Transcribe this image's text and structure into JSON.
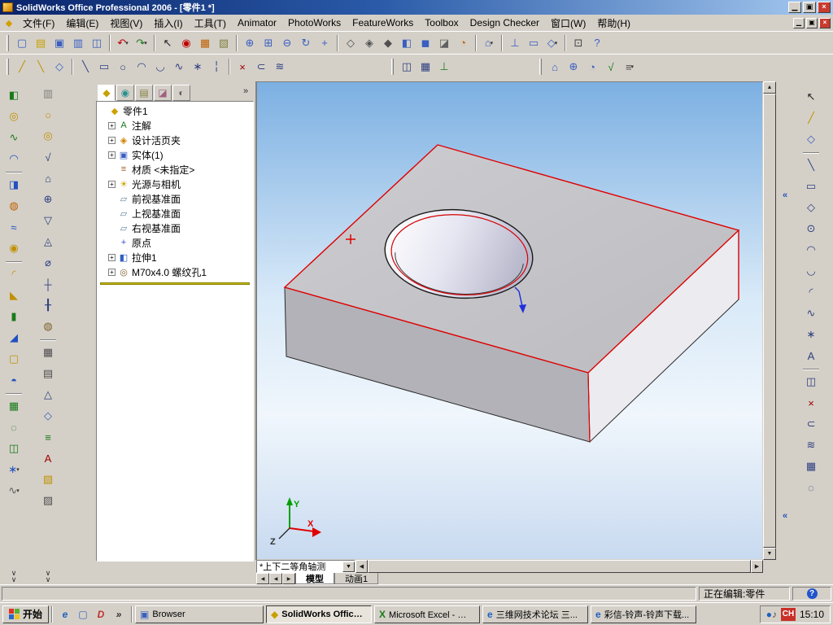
{
  "colors": {
    "titlebar_start": "#0a246a",
    "titlebar_end": "#a6caf0",
    "edge_highlight": "#e00000",
    "viewport_gradient_top": "#7cb0e2",
    "rollback_bar": "#c8b800",
    "help_badge": "#2255cc"
  },
  "window": {
    "title": "SolidWorks Office Professional 2006 - [零件1 *]",
    "doc_icon": "◆",
    "controls": {
      "minimize": "▁",
      "restore": "▣",
      "close": "×"
    }
  },
  "menubar": {
    "items": [
      "文件(F)",
      "编辑(E)",
      "视图(V)",
      "插入(I)",
      "工具(T)",
      "Animator",
      "PhotoWorks",
      "FeatureWorks",
      "Toolbox",
      "Design Checker",
      "窗口(W)",
      "帮助(H)"
    ]
  },
  "toolbars": {
    "dropdown_glyph": "▾",
    "collapse_glyph": "«",
    "more_glyph": "∨",
    "row1": [
      {
        "grip": 1
      },
      {
        "n": "new-document",
        "g": "▢",
        "c": "#3a5fc0"
      },
      {
        "n": "open",
        "g": "▤",
        "c": "#c8a000"
      },
      {
        "n": "save",
        "g": "▣",
        "c": "#3a5fc0"
      },
      {
        "n": "print",
        "g": "▥",
        "c": "#3a5fc0"
      },
      {
        "n": "print-preview",
        "g": "◫",
        "c": "#3a5fc0"
      },
      {
        "sep": 1
      },
      {
        "n": "undo",
        "g": "↶",
        "c": "#c00000",
        "d": 1
      },
      {
        "n": "redo",
        "g": "↷",
        "c": "#1a7a1a",
        "d": 1
      },
      {
        "sep": 1
      },
      {
        "n": "select",
        "g": "↖",
        "c": "#202020"
      },
      {
        "n": "rebuild",
        "g": "◉",
        "c": "#c00000"
      },
      {
        "n": "edit-color",
        "g": "▦",
        "c": "#c06000"
      },
      {
        "n": "texture",
        "g": "▧",
        "c": "#808040"
      },
      {
        "sep": 1
      },
      {
        "n": "zoom-to-fit",
        "g": "⊕",
        "c": "#3a5fc0"
      },
      {
        "n": "zoom-to-area",
        "g": "⊞",
        "c": "#3a5fc0"
      },
      {
        "n": "zoom-in-out",
        "g": "⊖",
        "c": "#3a5fc0"
      },
      {
        "n": "rotate-view",
        "g": "↻",
        "c": "#3a5fc0"
      },
      {
        "n": "pan",
        "g": "+",
        "c": "#3a5fc0"
      },
      {
        "sep": 1
      },
      {
        "n": "wireframe",
        "g": "◇",
        "c": "#505050"
      },
      {
        "n": "hidden-lines-visible",
        "g": "◈",
        "c": "#505050"
      },
      {
        "n": "hidden-lines-removed",
        "g": "◆",
        "c": "#505050"
      },
      {
        "n": "shaded-with-edges",
        "g": "◧",
        "c": "#3a5fc0"
      },
      {
        "n": "shaded",
        "g": "◼",
        "c": "#3a5fc0"
      },
      {
        "n": "shadows-in-shaded-mode",
        "g": "◪",
        "c": "#606060"
      },
      {
        "n": "section-view",
        "g": "◔",
        "c": "#c06000"
      },
      {
        "sep": 1
      },
      {
        "n": "standard-views",
        "g": "⌂",
        "c": "#3a5fc0",
        "d": 1
      },
      {
        "sep": 1
      },
      {
        "n": "normal-to",
        "g": "⊥",
        "c": "#3a5fc0"
      },
      {
        "n": "front-view",
        "g": "▭",
        "c": "#3a5fc0"
      },
      {
        "n": "isometric-view",
        "g": "◇",
        "c": "#3a5fc0",
        "d": 1
      },
      {
        "sep": 1
      },
      {
        "n": "full-screen",
        "g": "⊡",
        "c": "#404040"
      },
      {
        "n": "help",
        "g": "?",
        "c": "#3a5fc0"
      }
    ],
    "row2": [
      {
        "grip": 1
      },
      {
        "n": "sketch",
        "g": "╱",
        "c": "#c09000"
      },
      {
        "n": "3d-sketch",
        "g": "╲",
        "c": "#c09000"
      },
      {
        "n": "smart-dimension",
        "g": "◇",
        "c": "#3a5fc0"
      },
      {
        "sep": 1
      },
      {
        "n": "line",
        "g": "╲",
        "c": "#304080"
      },
      {
        "n": "rectangle",
        "g": "▭",
        "c": "#304080"
      },
      {
        "n": "circle",
        "g": "○",
        "c": "#304080"
      },
      {
        "n": "centerpoint-arc",
        "g": "◠",
        "c": "#304080"
      },
      {
        "n": "tangent-arc",
        "g": "◡",
        "c": "#304080"
      },
      {
        "n": "spline",
        "g": "∿",
        "c": "#304080"
      },
      {
        "n": "point",
        "g": "∗",
        "c": "#304080"
      },
      {
        "n": "centerline",
        "g": "╎",
        "c": "#304080"
      },
      {
        "sep": 1
      },
      {
        "n": "trim-entities",
        "g": "×",
        "c": "#a00000"
      },
      {
        "n": "convert-entities",
        "g": "⊂",
        "c": "#304080"
      },
      {
        "n": "offset-entities",
        "g": "≋",
        "c": "#304080"
      },
      {
        "sp": 120
      },
      {
        "grip": 1
      },
      {
        "n": "mirror-entities",
        "g": "◫",
        "c": "#304080"
      },
      {
        "n": "linear-sketch-pattern",
        "g": "▦",
        "c": "#304080"
      },
      {
        "n": "add-relation",
        "g": "⊥",
        "c": "#1a7a1a"
      },
      {
        "sp": 100
      },
      {
        "grip": 1
      },
      {
        "n": "measure",
        "g": "⌂",
        "c": "#3a5fc0"
      },
      {
        "n": "mass-properties",
        "g": "⊕",
        "c": "#3a5fc0"
      },
      {
        "n": "section-properties",
        "g": "◔",
        "c": "#3a5fc0"
      },
      {
        "n": "check",
        "g": "√",
        "c": "#1a7a1a"
      },
      {
        "n": "options",
        "g": "≡",
        "c": "#505050",
        "d": 1
      }
    ],
    "left1": [
      {
        "n": "extruded-boss",
        "g": "◧",
        "c": "#1a7a1a"
      },
      {
        "n": "revolved-boss",
        "g": "◎",
        "c": "#c09000"
      },
      {
        "n": "swept-boss",
        "g": "∿",
        "c": "#1a7a1a"
      },
      {
        "n": "lofted-boss",
        "g": "◠",
        "c": "#2050c0"
      },
      {
        "sep": 1
      },
      {
        "n": "extruded-cut",
        "g": "◨",
        "c": "#2050c0"
      },
      {
        "n": "revolved-cut",
        "g": "◍",
        "c": "#c06000"
      },
      {
        "n": "swept-cut",
        "g": "≈",
        "c": "#2050c0"
      },
      {
        "n": "hole-wizard",
        "g": "◉",
        "c": "#c09000"
      },
      {
        "sep": 1
      },
      {
        "n": "fillet",
        "g": "◜",
        "c": "#c09000"
      },
      {
        "n": "chamfer",
        "g": "◣",
        "c": "#c09000"
      },
      {
        "n": "rib",
        "g": "▮",
        "c": "#1a7a1a"
      },
      {
        "n": "draft",
        "g": "◢",
        "c": "#2050c0"
      },
      {
        "n": "shell",
        "g": "▢",
        "c": "#c09000"
      },
      {
        "n": "dome",
        "g": "◓",
        "c": "#2050c0"
      },
      {
        "sep": 1
      },
      {
        "n": "linear-pattern",
        "g": "▦",
        "c": "#1a7a1a"
      },
      {
        "n": "circular-pattern",
        "g": "◌",
        "c": "#1a7a1a"
      },
      {
        "n": "mirror-feature",
        "g": "◫",
        "c": "#1a7a1a"
      },
      {
        "n": "reference-geometry",
        "g": "∗",
        "c": "#2050c0",
        "d": 1
      },
      {
        "n": "curves",
        "g": "∿",
        "c": "#606060",
        "d": 1
      }
    ],
    "left2": [
      {
        "n": "note",
        "g": "▥",
        "c": "#808080"
      },
      {
        "n": "balloon",
        "g": "○",
        "c": "#c09000"
      },
      {
        "n": "stacked-balloon",
        "g": "◎",
        "c": "#c09000"
      },
      {
        "n": "surface-finish",
        "g": "√",
        "c": "#304080"
      },
      {
        "n": "weld-symbol",
        "g": "⌂",
        "c": "#304080"
      },
      {
        "n": "geometric-tolerance",
        "g": "⊕",
        "c": "#304080"
      },
      {
        "n": "datum-feature",
        "g": "▽",
        "c": "#304080"
      },
      {
        "n": "datum-target",
        "g": "◬",
        "c": "#304080"
      },
      {
        "n": "hole-callout",
        "g": "⌀",
        "c": "#304080"
      },
      {
        "n": "center-mark",
        "g": "┼",
        "c": "#304080"
      },
      {
        "n": "centerline-annotation",
        "g": "╂",
        "c": "#304080"
      },
      {
        "n": "cosmetic-thread",
        "g": "◍",
        "c": "#806030"
      },
      {
        "sep": 1
      },
      {
        "n": "block",
        "g": "▦",
        "c": "#505050"
      },
      {
        "n": "table",
        "g": "▤",
        "c": "#505050"
      },
      {
        "n": "revision-symbol",
        "g": "△",
        "c": "#304080"
      },
      {
        "n": "smart-dimension-2",
        "g": "◇",
        "c": "#3a5fc0"
      },
      {
        "n": "model-items",
        "g": "≡",
        "c": "#1a7a1a"
      },
      {
        "n": "spell-checker",
        "g": "A",
        "c": "#a00000"
      },
      {
        "n": "format-painter",
        "g": "▧",
        "c": "#c09000"
      },
      {
        "n": "layer-properties",
        "g": "▨",
        "c": "#505050"
      }
    ],
    "right": [
      {
        "n": "select-tool",
        "g": "↖",
        "c": "#202020"
      },
      {
        "n": "sketch-tool",
        "g": "╱",
        "c": "#c09000"
      },
      {
        "n": "smart-dimension-tool",
        "g": "◇",
        "c": "#3a5fc0"
      },
      {
        "sep": 1
      },
      {
        "n": "line-tool",
        "g": "╲",
        "c": "#304080"
      },
      {
        "n": "rectangle-tool",
        "g": "▭",
        "c": "#304080"
      },
      {
        "n": "polygon-tool",
        "g": "◇",
        "c": "#304080"
      },
      {
        "n": "circle-tool",
        "g": "⊙",
        "c": "#304080"
      },
      {
        "n": "centerpoint-arc-tool",
        "g": "◠",
        "c": "#304080"
      },
      {
        "n": "tangent-arc-tool",
        "g": "◡",
        "c": "#304080"
      },
      {
        "n": "3-point-arc-tool",
        "g": "◜",
        "c": "#304080"
      },
      {
        "n": "spline-tool",
        "g": "∿",
        "c": "#304080"
      },
      {
        "n": "point-tool",
        "g": "∗",
        "c": "#304080"
      },
      {
        "n": "text-tool",
        "g": "A",
        "c": "#304080"
      },
      {
        "sep": 1
      },
      {
        "n": "mirror-tool",
        "g": "◫",
        "c": "#304080"
      },
      {
        "n": "trim-tool",
        "g": "×",
        "c": "#a00000"
      },
      {
        "n": "convert-entities-tool",
        "g": "⊂",
        "c": "#304080"
      },
      {
        "n": "offset-entities-tool",
        "g": "≋",
        "c": "#304080"
      },
      {
        "n": "linear-sketch-pattern-tool",
        "g": "▦",
        "c": "#304080"
      },
      {
        "n": "circular-sketch-pattern-tool",
        "g": "◌",
        "c": "#304080"
      }
    ]
  },
  "feature_panel": {
    "overflow": "»",
    "expand_glyph": "+",
    "tabs": [
      {
        "n": "feature-manager",
        "g": "◆",
        "c": "#c8a000"
      },
      {
        "n": "property-manager",
        "g": "◉",
        "c": "#2a9090"
      },
      {
        "n": "configuration-manager",
        "g": "▤",
        "c": "#808040"
      },
      {
        "n": "third-party",
        "g": "◪",
        "c": "#a06080"
      },
      {
        "n": "display-pane",
        "g": "◐",
        "c": "#606060"
      }
    ],
    "tree": {
      "root": {
        "n": "part",
        "g": "◆",
        "c": "#d0a000",
        "label": "零件1"
      },
      "items": [
        {
          "n": "annotations",
          "g": "A",
          "c": "#1a7a1a",
          "label": "注解",
          "exp": true
        },
        {
          "n": "design-binder",
          "g": "◈",
          "c": "#d08000",
          "label": "设计活页夹",
          "exp": true
        },
        {
          "n": "solid-bodies",
          "g": "▣",
          "c": "#3a5fc0",
          "label": "实体(1)",
          "exp": true
        },
        {
          "n": "material",
          "g": "≡",
          "c": "#a05a20",
          "label": "材质 <未指定>",
          "exp": false
        },
        {
          "n": "lights-and-cameras",
          "g": "☀",
          "c": "#c8a000",
          "label": "光源与相机",
          "exp": true
        },
        {
          "n": "front-plane",
          "g": "▱",
          "c": "#6080a0",
          "label": "前视基准面",
          "exp": false
        },
        {
          "n": "top-plane",
          "g": "▱",
          "c": "#6080a0",
          "label": "上视基准面",
          "exp": false
        },
        {
          "n": "right-plane",
          "g": "▱",
          "c": "#6080a0",
          "label": "右视基准面",
          "exp": false
        },
        {
          "n": "origin",
          "g": "+",
          "c": "#3050c0",
          "label": "原点",
          "exp": false
        },
        {
          "n": "extrude1",
          "g": "◧",
          "c": "#3060c0",
          "label": "拉伸1",
          "exp": true
        },
        {
          "n": "thread-hole",
          "g": "◎",
          "c": "#806030",
          "label": "M70x4.0 螺纹孔1",
          "exp": true
        }
      ]
    }
  },
  "viewport": {
    "orientation_label": "*上下二等角轴测",
    "tabs": [
      {
        "label": "模型",
        "active": true
      },
      {
        "label": "动画1",
        "active": false
      }
    ],
    "triad": {
      "x": "X",
      "y": "Y",
      "z": "Z"
    }
  },
  "scroll": {
    "up": "▲",
    "down": "▼",
    "left": "◀",
    "right": "▶",
    "combo": "▼",
    "tab_first": "◀",
    "tab_prev": "◀",
    "tab_next": "▶"
  },
  "statusbar": {
    "editing": "正在编辑:零件",
    "help": "?"
  },
  "taskbar": {
    "start_label": "开始",
    "quick_launch": [
      {
        "n": "internet-explorer",
        "g": "e",
        "c": "#2060c0"
      },
      {
        "n": "show-desktop",
        "g": "▢",
        "c": "#3a5fc0"
      },
      {
        "n": "media-player",
        "g": "D",
        "c": "#c03030"
      },
      {
        "n": "launch-overflow",
        "g": "»",
        "c": "#303030"
      }
    ],
    "windows": [
      {
        "n": "browser",
        "label": "Browser",
        "g": "▣",
        "c": "#3a5fc0",
        "active": false,
        "w": 158
      },
      {
        "n": "solidworks",
        "label": "SolidWorks Office Prof...",
        "g": "◆",
        "c": "#c8a000",
        "active": true
      },
      {
        "n": "excel",
        "label": "Microsoft Excel - 中信...",
        "g": "X",
        "c": "#1a7a1a",
        "active": false
      },
      {
        "n": "forum",
        "label": "三维网技术论坛 三...",
        "g": "e",
        "c": "#2060c0",
        "active": false
      },
      {
        "n": "ringtone",
        "label": "彩信-铃声-铃声下载...",
        "g": "e",
        "c": "#2060c0",
        "active": false
      }
    ],
    "tray": {
      "icons": [
        {
          "n": "antivirus",
          "g": "●",
          "c": "#2060c0"
        },
        {
          "n": "media",
          "g": "♪",
          "c": "#505050"
        }
      ],
      "input_indicator": "CH",
      "time": "15:10"
    }
  }
}
